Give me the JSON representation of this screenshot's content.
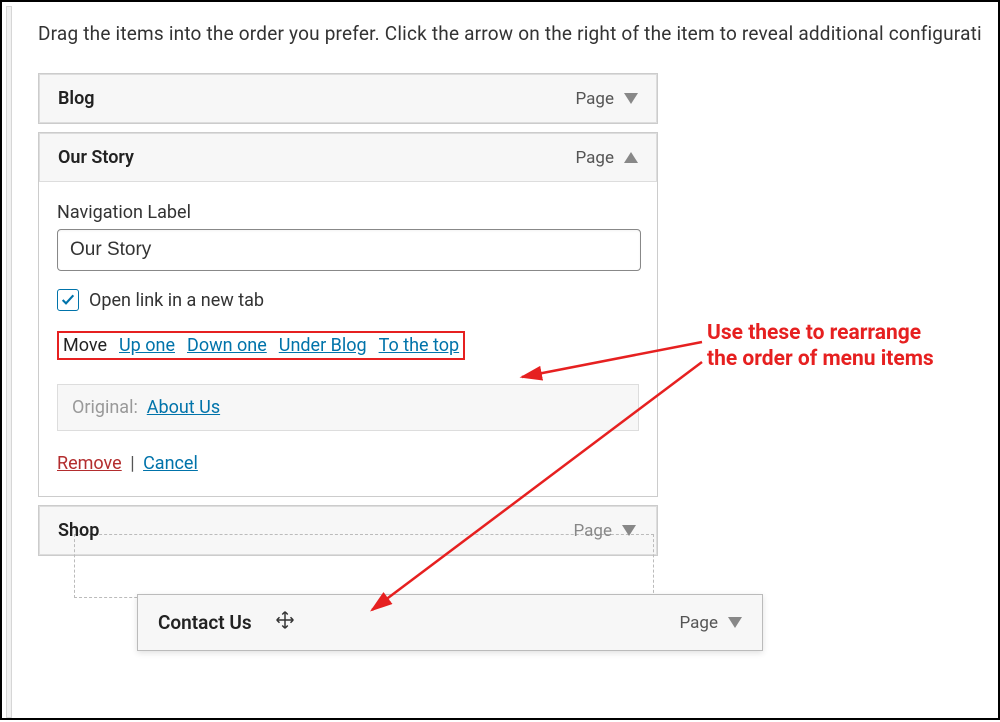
{
  "intro": "Drag the items into the order you prefer. Click the arrow on the right of the item to reveal additional configurati",
  "items": {
    "blog": {
      "title": "Blog",
      "type": "Page"
    },
    "our_story": {
      "title": "Our Story",
      "type": "Page",
      "nav_label_caption": "Navigation Label",
      "nav_label_value": "Our Story",
      "open_new_tab_label": "Open link in a new tab",
      "open_new_tab_checked": true,
      "move_label": "Move",
      "move": {
        "up": "Up one",
        "down": "Down one",
        "under": "Under Blog",
        "top": "To the top"
      },
      "original_label": "Original:",
      "original_link": "About Us",
      "remove": "Remove",
      "cancel": "Cancel"
    },
    "shop": {
      "title": "Shop",
      "type": "Page"
    },
    "contact": {
      "title": "Contact Us",
      "type": "Page"
    }
  },
  "annotation": {
    "line1": "Use these to rearrange",
    "line2": "the order of menu items"
  }
}
